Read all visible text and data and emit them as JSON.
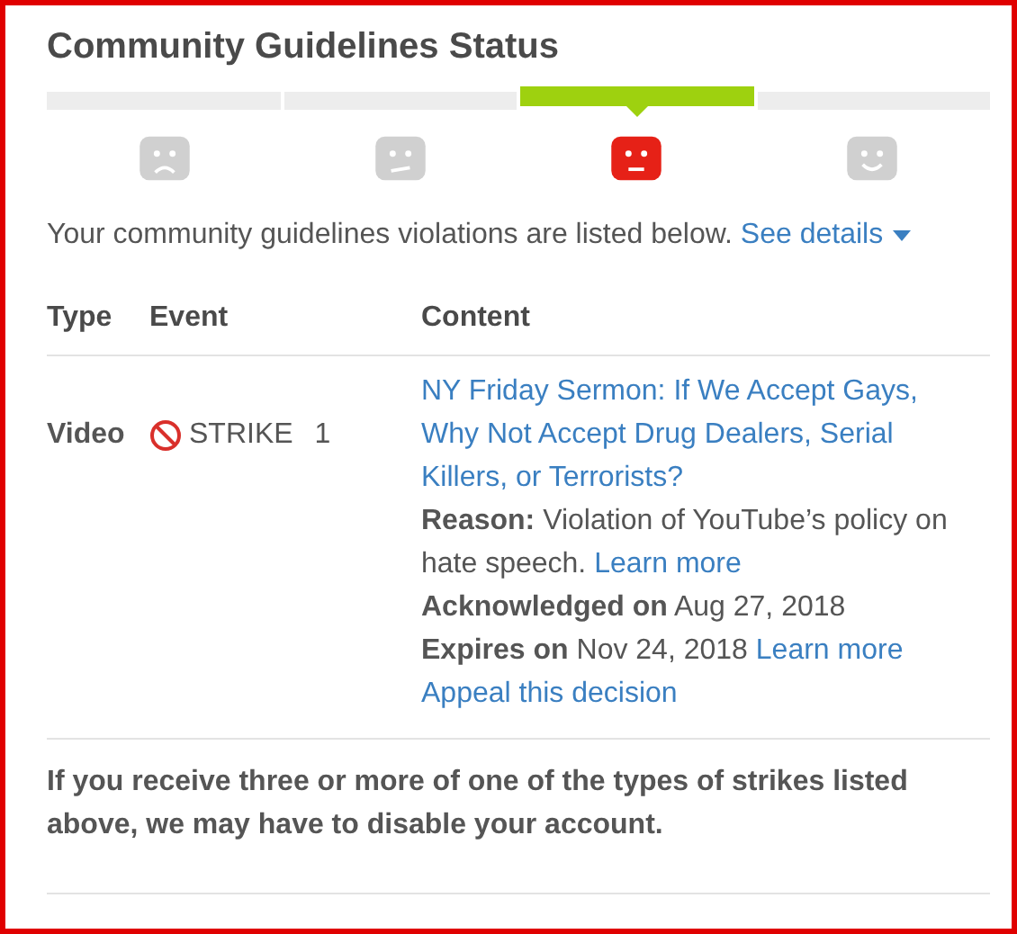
{
  "title": "Community Guidelines Status",
  "status_levels": [
    {
      "kind": "sad",
      "selected": false
    },
    {
      "kind": "uneasy",
      "selected": false
    },
    {
      "kind": "neutral",
      "selected": true
    },
    {
      "kind": "happy",
      "selected": false
    }
  ],
  "summary": {
    "text": "Your community guidelines violations are listed below.",
    "link": "See details"
  },
  "table": {
    "columns": [
      "Type",
      "Event",
      "Content"
    ],
    "rows": [
      {
        "type": "Video",
        "event": "STRIKE",
        "event_count": "1",
        "content_title": "NY Friday Sermon: If We Accept Gays, Why Not Accept Drug Dealers, Serial Killers, or Terrorists?",
        "reason": "**Reason:** Violation of YouTube’s policy on hate speech.",
        "reason_link": "Learn more",
        "acknowledged": "**Acknowledged on** Aug 27, 2018",
        "expires": "**Expires on** Nov 24, 2018",
        "expires_link": "Learn more",
        "appeal": "Appeal this decision"
      }
    ]
  },
  "footer_note": "If you receive three or more of one of the types of strikes listed above, we may have to disable your account."
}
